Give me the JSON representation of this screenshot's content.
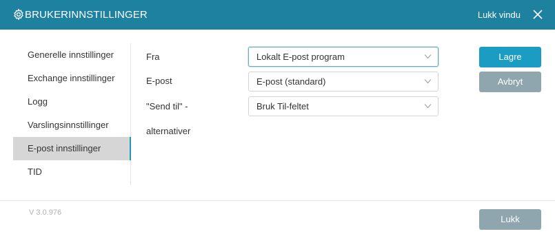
{
  "header": {
    "title": "BRUKERINNSTILLINGER",
    "close_window_label": "Lukk vindu",
    "gear_icon": "gear-icon",
    "close_icon": "close-icon",
    "background_color": "#1d819f"
  },
  "sidebar": {
    "items": [
      {
        "label": "Generelle innstillinger",
        "active": false
      },
      {
        "label": "Exchange innstillinger",
        "active": false
      },
      {
        "label": "Logg",
        "active": false
      },
      {
        "label": "Varslingsinnstillinger",
        "active": false
      },
      {
        "label": "E-post innstillinger",
        "active": true
      },
      {
        "label": "TID",
        "active": false
      }
    ],
    "active_accent": "#2196b7"
  },
  "form": {
    "fra": {
      "label": "Fra",
      "value": "Lokalt E-post program"
    },
    "epost": {
      "label": "E-post",
      "value": "E-post (standard)"
    },
    "send_til": {
      "label_line1": "\"Send til\" -",
      "label_line2": "alternativer",
      "value": "Bruk Til-feltet"
    }
  },
  "buttons": {
    "save": "Lagre",
    "cancel": "Avbryt",
    "close": "Lukk"
  },
  "footer": {
    "version": "V 3.0.976"
  }
}
